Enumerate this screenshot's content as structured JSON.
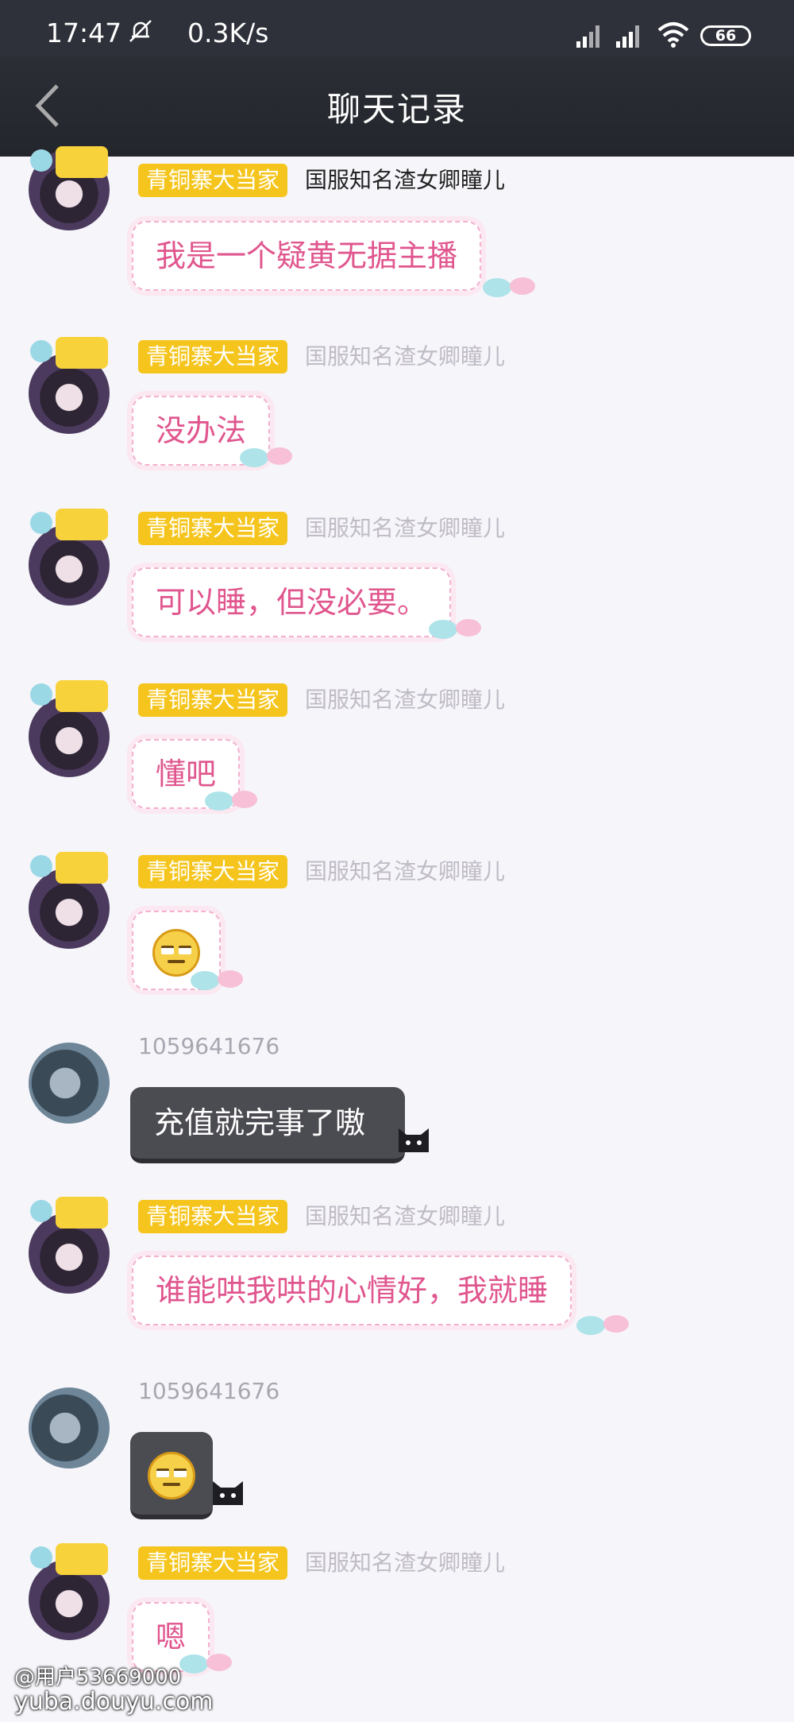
{
  "status_bar": {
    "time": "17:47",
    "net_speed": "0.3K/s",
    "battery": "66"
  },
  "nav": {
    "title": "聊天记录"
  },
  "messages": [
    {
      "badge": "青铜寨大当家",
      "name": "国服知名渣女卿瞳儿",
      "text": "我是一个疑黄无据主播"
    },
    {
      "badge": "青铜寨大当家",
      "name": "国服知名渣女卿瞳儿",
      "text": "没办法"
    },
    {
      "badge": "青铜寨大当家",
      "name": "国服知名渣女卿瞳儿",
      "text": "可以睡，但没必要。"
    },
    {
      "badge": "青铜寨大当家",
      "name": "国服知名渣女卿瞳儿",
      "text": "懂吧"
    },
    {
      "badge": "青铜寨大当家",
      "name": "国服知名渣女卿瞳儿",
      "emoji": "smirk-emoji"
    },
    {
      "user_id": "1059641676",
      "text": "充值就完事了嗷"
    },
    {
      "badge": "青铜寨大当家",
      "name": "国服知名渣女卿瞳儿",
      "text": "谁能哄我哄的心情好，我就睡"
    },
    {
      "user_id": "1059641676",
      "emoji": "smirk-emoji"
    },
    {
      "badge": "青铜寨大当家",
      "name": "国服知名渣女卿瞳儿",
      "text": "嗯"
    }
  ],
  "watermark": {
    "user": "@用户53669000",
    "site": "yuba.douyu.com"
  }
}
